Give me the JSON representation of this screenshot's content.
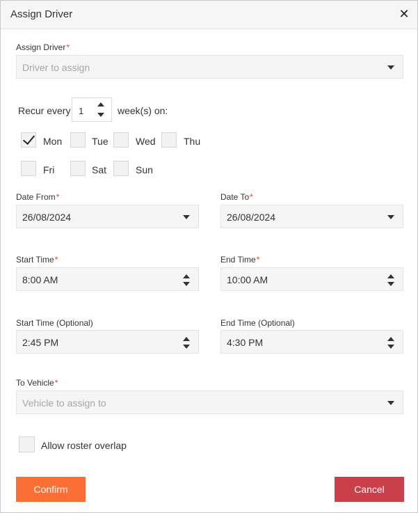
{
  "dialog": {
    "title": "Assign Driver"
  },
  "assign_driver": {
    "label": "Assign Driver",
    "required": "*",
    "placeholder": "Driver to assign"
  },
  "recurrence": {
    "prefix": "Recur every",
    "value": "1",
    "suffix": "week(s) on:",
    "days": [
      {
        "label": "Mon",
        "checked": true
      },
      {
        "label": "Tue",
        "checked": false
      },
      {
        "label": "Wed",
        "checked": false
      },
      {
        "label": "Thu",
        "checked": false
      },
      {
        "label": "Fri",
        "checked": false
      },
      {
        "label": "Sat",
        "checked": false
      },
      {
        "label": "Sun",
        "checked": false
      }
    ]
  },
  "date_from": {
    "label": "Date From",
    "required": "*",
    "value": "26/08/2024"
  },
  "date_to": {
    "label": "Date To",
    "required": "*",
    "value": "26/08/2024"
  },
  "start_time": {
    "label": "Start Time",
    "required": "*",
    "value": "8:00 AM"
  },
  "end_time": {
    "label": "End Time",
    "required": "*",
    "value": "10:00 AM"
  },
  "start_time_optional": {
    "label": "Start Time (Optional)",
    "value": "2:45 PM"
  },
  "end_time_optional": {
    "label": "End Time (Optional)",
    "value": "4:30 PM"
  },
  "to_vehicle": {
    "label": "To Vehicle",
    "required": "*",
    "placeholder": "Vehicle to assign to"
  },
  "allow_overlap": {
    "label": "Allow roster overlap",
    "checked": false
  },
  "buttons": {
    "confirm": "Confirm",
    "cancel": "Cancel"
  },
  "colors": {
    "confirm": "#fb6f36",
    "cancel": "#c9404a",
    "required": "#e8383d"
  }
}
